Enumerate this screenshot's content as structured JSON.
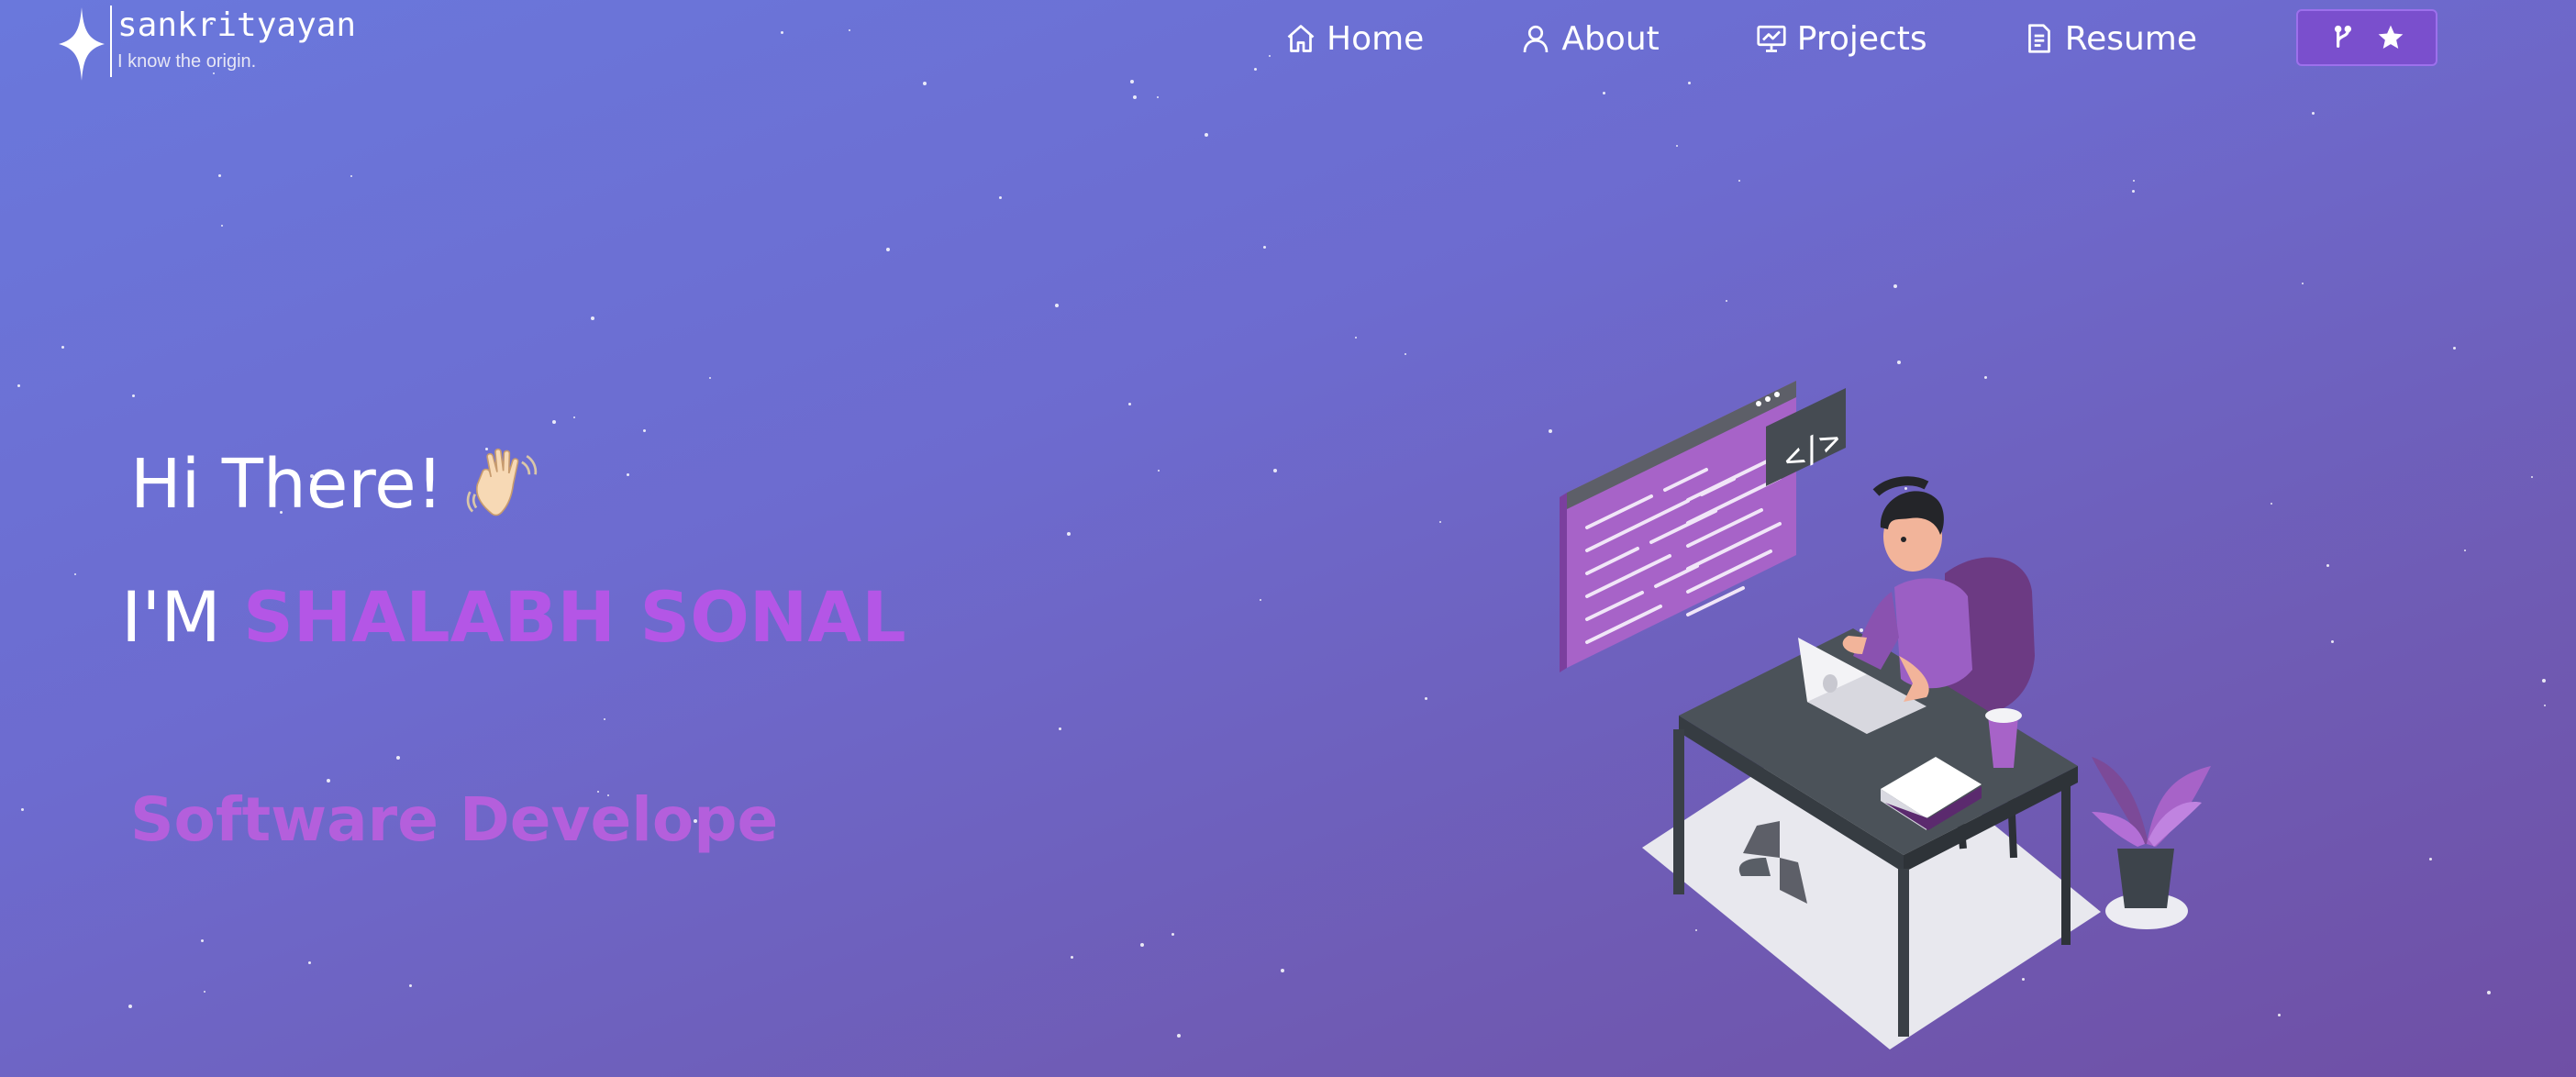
{
  "brand": {
    "title": "sankrityayan",
    "tagline": "I know the origin."
  },
  "nav": {
    "items": [
      {
        "label": "Home",
        "icon": "home-icon"
      },
      {
        "label": "About",
        "icon": "user-icon"
      },
      {
        "label": "Projects",
        "icon": "presentation-icon"
      },
      {
        "label": "Resume",
        "icon": "document-icon"
      }
    ],
    "github_button": {
      "icons": [
        "git-fork-icon",
        "star-icon"
      ]
    }
  },
  "hero": {
    "greeting": "Hi There!",
    "name_prefix": "I'M",
    "name": "SHALABH SONAL",
    "typed_text": "Software Develope"
  },
  "colors": {
    "background_start": "#6a78dc",
    "background_end": "#6f4fa5",
    "accent": "#b456e6",
    "button": "#7a4fcd"
  }
}
